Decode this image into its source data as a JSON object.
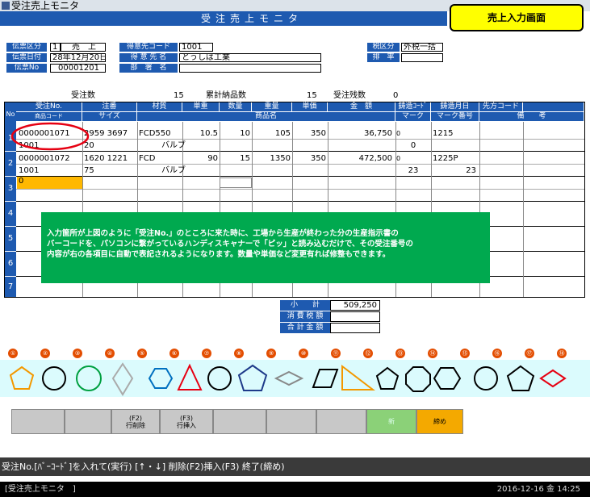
{
  "window": {
    "title": "受注売上モニタ",
    "screen_title": "受注売上モニタ",
    "note_box": "売上入力画面"
  },
  "header": {
    "denpyo_kubun_label": "伝票区分",
    "denpyo_kubun_code": "1",
    "denpyo_kubun_value": "売　上",
    "denpyo_date_label": "伝票日付",
    "denpyo_date_value": "28年12月20日",
    "denpyo_no_label": "伝票No",
    "denpyo_no_value": "00001201",
    "customer_code_label": "得意先コード",
    "customer_code_value": "1001",
    "customer_name_label": "得 意 先 名",
    "customer_name_value": "とうしば工業",
    "dept_label": "部　署　名",
    "dept_value": "",
    "tax_kubun_label": "税区分",
    "tax_kubun_value": "外税一括",
    "tax_rate_label": "排　率",
    "tax_rate_value": ""
  },
  "summary": {
    "juchu_label": "受注数",
    "juchu_value": "15",
    "nouhin_label": "累計納品数",
    "nouhin_value": "15",
    "zan_label": "受注残数",
    "zan_value": "0"
  },
  "grid": {
    "no_label": "No",
    "headers_top": [
      "受注No.",
      "注番",
      "材質",
      "単重",
      "数量",
      "重量",
      "単価",
      "金　額",
      "鋳造ｺｰﾄﾞ",
      "鋳造月日",
      "先方コード"
    ],
    "headers_bottom": [
      "商品コード",
      "サイズ",
      "商品名",
      "マーク",
      "マーク番号",
      "備　　考"
    ],
    "rows": [
      {
        "no": "1",
        "juchu_no": "0000001071",
        "chuban": "2959 3697",
        "zaishitsu": "FCD550",
        "tanju": "10.5",
        "suryo": "10",
        "juryo": "105",
        "tanka": "350",
        "kingaku": "36,750",
        "chuzo_code": "0",
        "chuzo_date": "1215",
        "senpo": "",
        "shohin_code": "1001",
        "size": "20",
        "shohin_mei": "バルブ",
        "mark": "0",
        "mark_no": "",
        "biko": ""
      },
      {
        "no": "2",
        "juchu_no": "0000001072",
        "chuban": "1620 1221",
        "zaishitsu": "FCD",
        "tanju": "90",
        "suryo": "15",
        "juryo": "1350",
        "tanka": "350",
        "kingaku": "472,500",
        "chuzo_code": "0",
        "chuzo_date": "1225P",
        "senpo": "",
        "shohin_code": "1001",
        "size": "75",
        "shohin_mei": "バルブ",
        "mark": "23",
        "mark_no": "23",
        "biko": ""
      },
      {
        "no": "3",
        "juchu_no": "0"
      },
      {
        "no": "4"
      },
      {
        "no": "5"
      },
      {
        "no": "6"
      },
      {
        "no": "7"
      }
    ]
  },
  "callout": {
    "line1": "入力箇所が上図のように「受注No.」のところに来た時に、工場から生産が終わった分の生産指示書の",
    "line2": "バーコードを、パソコンに繋がっているハンディスキャナーで「ピッ」と読み込むだけで、その受注番号の",
    "line3": "内容が右の各項目に自動で表記されるようになります。数量や単価など変更有れば修整もできます。"
  },
  "totals": {
    "subtotal_label": "小　　計",
    "subtotal_value": "509,250",
    "tax_label": "消 費 税 額",
    "tax_value": "",
    "total_label": "合 計 金 額",
    "total_value": ""
  },
  "shape_numbers": [
    "①",
    "②",
    "③",
    "④",
    "⑤",
    "⑥",
    "⑦",
    "⑧",
    "⑨",
    "⑩",
    "⑪",
    "⑫",
    "⑬",
    "⑭",
    "⑮",
    "⑯",
    "⑰",
    "⑱"
  ],
  "fkeys": {
    "f2": "(F2)\n行削除",
    "f3": "(F3)\n行挿入",
    "f10": "新",
    "f11": "締め"
  },
  "status": {
    "message": "受注No.[ﾊﾞｰｺｰﾄﾞ]を入れて(実行) [↑・↓] 削除(F2)挿入(F3) 終了(締め)",
    "taskbar": "[受注売上モニタ　]",
    "clock": "2016-12-16 金 14:25"
  },
  "colors": {
    "accent_blue": "#1e5ab0",
    "callout_green": "#00a94f",
    "note_yellow": "#ffff00",
    "highlight_red": "#e60012",
    "shape_strip": "#dbfbfd"
  }
}
